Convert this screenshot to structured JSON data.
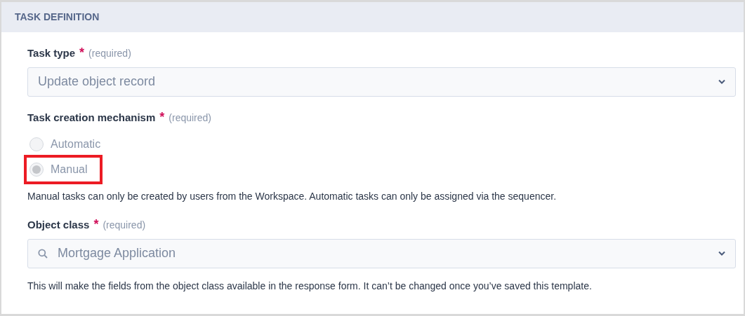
{
  "section": {
    "title": "TASK DEFINITION"
  },
  "fields": [
    {
      "kind": "select",
      "label": "Task type",
      "required_mark": "*",
      "required_text": "(required)",
      "value": "Update object record"
    },
    {
      "kind": "radio",
      "label": "Task creation mechanism",
      "required_mark": "*",
      "required_text": "(required)",
      "options": [
        {
          "label": "Automatic",
          "selected": false,
          "highlighted": false
        },
        {
          "label": "Manual",
          "selected": true,
          "highlighted": true
        }
      ],
      "help": "Manual tasks can only be created by users from the Workspace. Automatic tasks can only be assigned via the sequencer."
    },
    {
      "kind": "search-select",
      "label": "Object class",
      "required_mark": "*",
      "required_text": "(required)",
      "value": "Mortgage Application",
      "help": "This will make the fields from the object class available in the response form. It can’t be changed once you’ve saved this template."
    }
  ]
}
